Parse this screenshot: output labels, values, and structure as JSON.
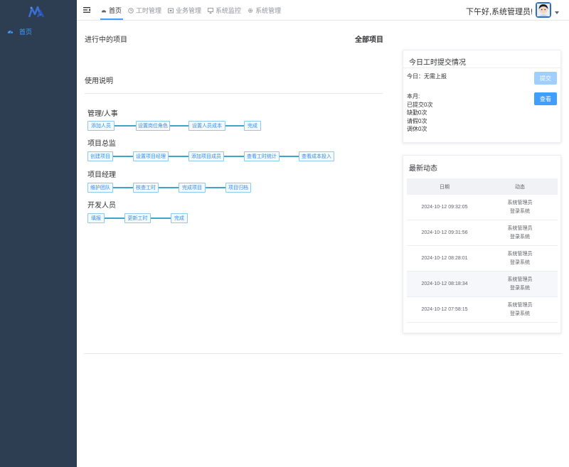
{
  "app": {
    "logo_icon": "cat-logo-icon",
    "accent": "#409eff",
    "sidebar_bg": "#2e3e52"
  },
  "sidebar": {
    "items": [
      {
        "label": "首页",
        "icon": "dashboard-icon"
      }
    ]
  },
  "navbar": {
    "menu": [
      {
        "label": "首页",
        "icon": "dashboard-icon"
      },
      {
        "label": "工时管理",
        "icon": "clock-icon"
      },
      {
        "label": "业务管理",
        "icon": "briefcase-icon"
      },
      {
        "label": "系统监控",
        "icon": "monitor-icon"
      },
      {
        "label": "系统管理",
        "icon": "gear-icon"
      }
    ],
    "greeting": "下午好,系统管理员!"
  },
  "main": {
    "ongoing_title": "进行中的项目",
    "all_projects": "全部项目",
    "usage_title": "使用说明",
    "groups": [
      {
        "title": "管理/人事",
        "steps": [
          "添加人员",
          "设置岗位角色",
          "设置人员成本",
          "完成"
        ]
      },
      {
        "title": "项目总监",
        "steps": [
          "创建项目",
          "设置项目经理",
          "添加项目成员",
          "查看工时统计",
          "查看成本投入"
        ]
      },
      {
        "title": "项目经理",
        "steps": [
          "维护团队",
          "核查工时",
          "完成项目",
          "项目归档"
        ]
      },
      {
        "title": "开发人员",
        "steps": [
          "填报",
          "更新工时",
          "完成"
        ]
      }
    ]
  },
  "timesheet": {
    "title": "今日工时提交情况",
    "today": "今日：无需上报",
    "submit_label": "提交",
    "view_label": "查看",
    "month_label": "本月:",
    "submitted": "已提交0次",
    "absent": "缺勤0次",
    "leave": "请假0次",
    "off": "调休0次"
  },
  "activity": {
    "title": "最新动态",
    "columns": [
      "日期",
      "动态"
    ],
    "rows": [
      {
        "date": "2024-10-12 09:32:05",
        "user": "系统管理员",
        "action": "登录系统"
      },
      {
        "date": "2024-10-12 09:31:56",
        "user": "系统管理员",
        "action": "登录系统"
      },
      {
        "date": "2024-10-12 08:28:01",
        "user": "系统管理员",
        "action": "登录系统"
      },
      {
        "date": "2024-10-12 08:18:34",
        "user": "系统管理员",
        "action": "登录系统"
      },
      {
        "date": "2024-10-12 07:58:15",
        "user": "系统管理员",
        "action": "登录系统"
      }
    ]
  }
}
